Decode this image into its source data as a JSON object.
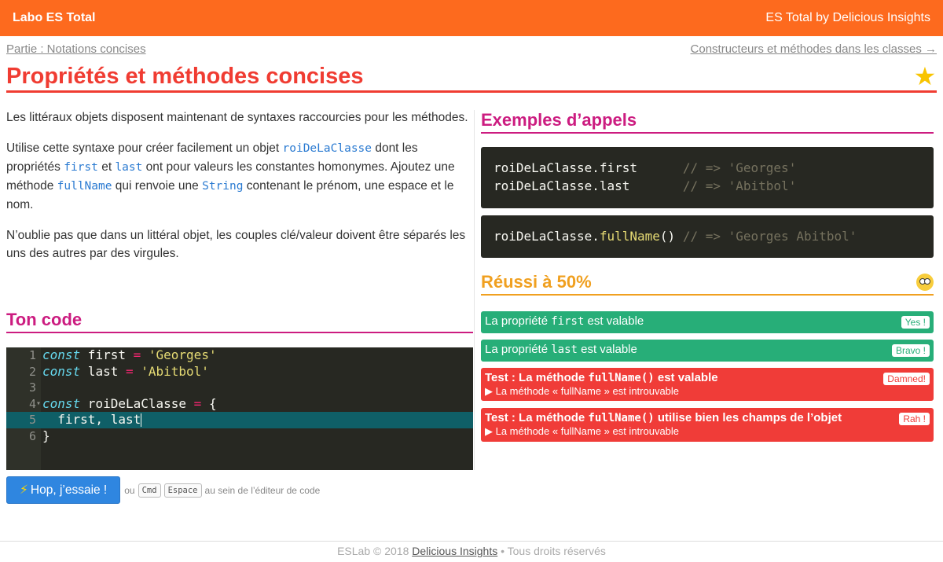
{
  "topbar": {
    "brand": "Labo ES Total",
    "by": "ES Total by Delicious Insights",
    "color": "#fd6a1e"
  },
  "breadcrumb": {
    "prev": "Partie : Notations concises",
    "next": "Constructeurs et méthodes dans les classes →"
  },
  "title": "Propriétés et méthodes concises",
  "star_icon": "★",
  "intro": {
    "p1": "Les littéraux objets disposent maintenant de syntaxes raccourcies pour les méthodes.",
    "p2a": "Utilise cette syntaxe pour créer facilement un objet ",
    "p2_code1": "roiDeLaClasse",
    "p2b": " dont les propriétés ",
    "p2_code2": "first",
    "p2c": " et ",
    "p2_code3": "last",
    "p2d": " ont pour valeurs les constantes homonymes. Ajoutez une méthode ",
    "p2_code4": "fullName",
    "p2e": " qui renvoie une ",
    "p2_code5": "String",
    "p2f": " contenant le prénom, une espace et le nom.",
    "p3": "N’oublie pas que dans un littéral objet, les couples clé/valeur doivent être séparés les uns des autres par des virgules."
  },
  "ton_code": "Ton code",
  "editor": {
    "lines": [
      {
        "n": "1",
        "kw": "const",
        "name": " first ",
        "op": "=",
        "str": " 'Georges'"
      },
      {
        "n": "2",
        "kw": "const",
        "name": " last ",
        "op": "=",
        "str": " 'Abitbol'"
      },
      {
        "n": "3"
      },
      {
        "n": "4",
        "kw": "const",
        "name": " roiDeLaClasse ",
        "op": "=",
        "rest": " {"
      },
      {
        "n": "5",
        "text": "  first, last"
      },
      {
        "n": "6",
        "text": "}"
      }
    ]
  },
  "try_button": {
    "icon": "⚡",
    "label": "Hop, j’essaie !"
  },
  "hint": {
    "ou": "ou",
    "k1": "Cmd",
    "k2": "Espace",
    "suffix": "au sein de l’éditeur de code"
  },
  "exemples": {
    "title": "Exemples d’appels",
    "l1_code": "roiDeLaClasse.first      ",
    "l1_comment": "// => 'Georges'",
    "l2_code": "roiDeLaClasse.last       ",
    "l2_comment": "// => 'Abitbol'",
    "l3_obj": "roiDeLaClasse.",
    "l3_fn": "fullName",
    "l3_paren": "() ",
    "l3_comment": "// => 'Georges Abitbol'"
  },
  "reussi": {
    "title": "Réussi à 50%",
    "emoji": "flushed-face-icon"
  },
  "results": [
    {
      "pre": "La propriété ",
      "code": "first",
      "post": " est valable",
      "badge": "Yes !",
      "status": "ok"
    },
    {
      "pre": "La propriété ",
      "code": "last",
      "post": " est valable",
      "badge": "Bravo !",
      "status": "ok"
    },
    {
      "pre": "Test : La méthode ",
      "code": "fullName()",
      "post": " est valable",
      "badge": "Damned!",
      "sub": "▶ La méthode « fullName » est introuvable",
      "status": "ko"
    },
    {
      "pre": "Test : La méthode ",
      "code": "fullName()",
      "post": " utilise bien les champs de l’objet",
      "badge": "Rah !",
      "sub": "▶ La méthode « fullName » est introuvable",
      "status": "ko"
    }
  ],
  "footer": {
    "left": "ESLab © 2018 ",
    "link": "Delicious Insights",
    "right": " • Tous droits réservés"
  }
}
